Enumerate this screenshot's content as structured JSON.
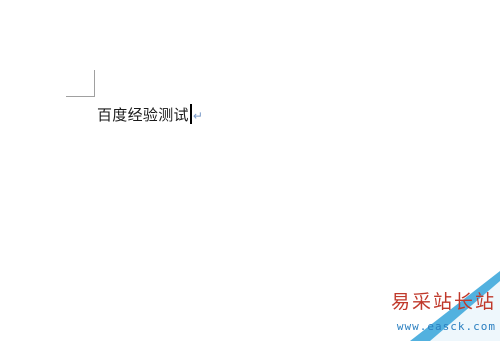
{
  "document": {
    "text": "百度经验测试",
    "paragraph_mark": "↵"
  },
  "watermark": {
    "title": "易采站长站",
    "url": "www.easck.com"
  },
  "colors": {
    "background": "#ffffff",
    "text": "#1a1a1a",
    "margin_mark": "#a0a0a0",
    "paragraph_mark": "#7a9ac8",
    "watermark_title": "#c0392b",
    "watermark_url": "#2a7fc0",
    "watermark_triangle": "#3fa9dc"
  }
}
